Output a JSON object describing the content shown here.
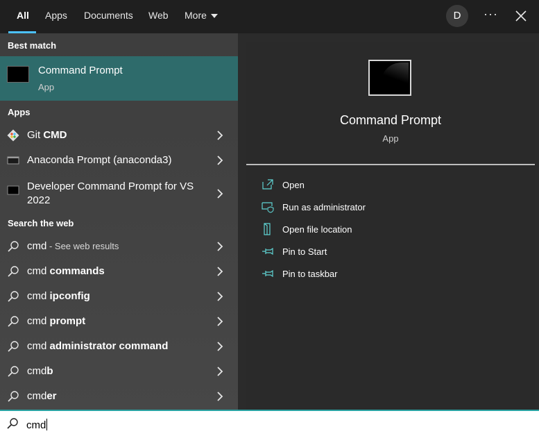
{
  "tabs": [
    "All",
    "Apps",
    "Documents",
    "Web",
    "More"
  ],
  "avatar_initial": "D",
  "more_menu_label": "···",
  "left": {
    "best_match_heading": "Best match",
    "best_match": {
      "title": "Command Prompt",
      "subtitle": "App"
    },
    "apps_heading": "Apps",
    "apps": [
      {
        "prefix": "Git ",
        "bold": "CMD"
      },
      {
        "prefix": "Anaconda Prompt (anaconda3)",
        "bold": ""
      },
      {
        "prefix": "Developer Command Prompt for VS 2022",
        "bold": ""
      }
    ],
    "web_heading": "Search the web",
    "web": [
      {
        "prefix": "cmd",
        "bold": "",
        "suffix": " - See web results"
      },
      {
        "prefix": "cmd ",
        "bold": "commands",
        "suffix": ""
      },
      {
        "prefix": "cmd ",
        "bold": "ipconfig",
        "suffix": ""
      },
      {
        "prefix": "cmd ",
        "bold": "prompt",
        "suffix": ""
      },
      {
        "prefix": "cmd ",
        "bold": "administrator command",
        "suffix": ""
      },
      {
        "prefix": "cmd",
        "bold": "b",
        "suffix": ""
      },
      {
        "prefix": "cmd",
        "bold": "er",
        "suffix": ""
      }
    ]
  },
  "right": {
    "title": "Command Prompt",
    "subtitle": "App",
    "actions": [
      "Open",
      "Run as administrator",
      "Open file location",
      "Pin to Start",
      "Pin to taskbar"
    ]
  },
  "search": {
    "value": "cmd"
  },
  "colors": {
    "accent": "#4cc2ff",
    "selection": "#2e6b6b",
    "search_border": "#2aa3a3"
  }
}
